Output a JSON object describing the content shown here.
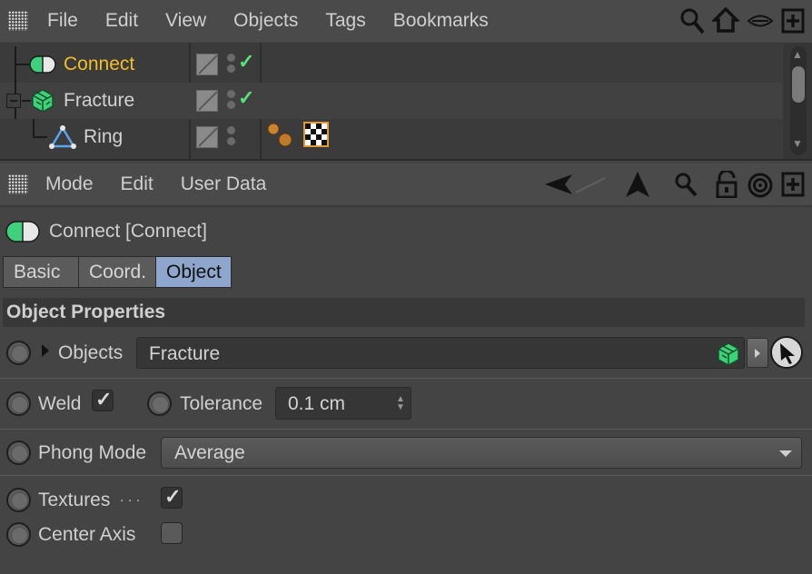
{
  "top_menu": {
    "items": [
      "File",
      "Edit",
      "View",
      "Objects",
      "Tags",
      "Bookmarks"
    ]
  },
  "objects": [
    {
      "name": "Connect",
      "color": "#f0bf2a",
      "icon": "connect-icon",
      "status": "check"
    },
    {
      "name": "Fracture",
      "color": "#d2d2d2",
      "icon": "fracture-icon",
      "status": "check"
    },
    {
      "name": "Ring",
      "color": "#d2d2d2",
      "icon": "ring-icon",
      "status": "none"
    }
  ],
  "attr_menu": {
    "items": [
      "Mode",
      "Edit",
      "User Data"
    ]
  },
  "object_title": "Connect [Connect]",
  "tabs": [
    "Basic",
    "Coord.",
    "Object"
  ],
  "active_tab": "Object",
  "section_heading": "Object Properties",
  "props": {
    "objects_label": "Objects",
    "objects_value": "Fracture",
    "weld_label": "Weld",
    "weld_checked": true,
    "tolerance_label": "Tolerance",
    "tolerance_value": "0.1 cm",
    "phong_label": "Phong Mode",
    "phong_value": "Average",
    "textures_label": "Textures",
    "textures_dots": ". . .",
    "textures_checked": true,
    "center_axis_label": "Center Axis",
    "center_axis_checked": false
  },
  "colors": {
    "accent_tab": "#8fa6cc",
    "active_object": "#f0bf2a",
    "check": "#58e07a"
  }
}
